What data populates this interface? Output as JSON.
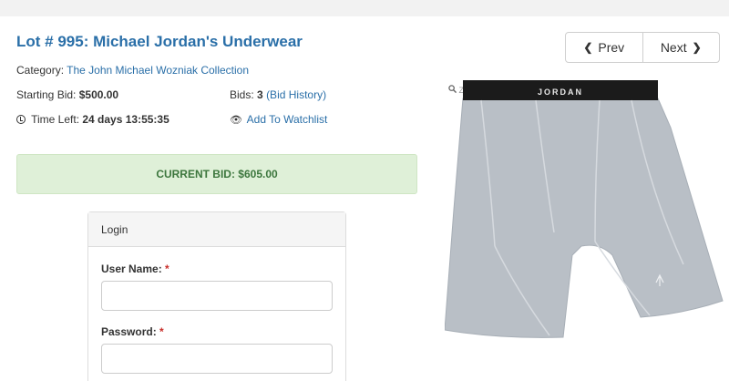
{
  "lot": {
    "title": "Lot # 995: Michael Jordan's Underwear",
    "category_label": "Category:",
    "category_value": "The John Michael Wozniak Collection",
    "starting_bid_label": "Starting Bid:",
    "starting_bid_value": "$500.00",
    "bids_label": "Bids:",
    "bids_count": "3",
    "bid_history_link": "(Bid History)",
    "time_left_label": "Time Left:",
    "time_left_value": "24 days 13:55:35",
    "watchlist_link": "Add To Watchlist",
    "current_bid": "CURRENT BID: $605.00"
  },
  "pager": {
    "prev_label": "Prev",
    "next_label": "Next"
  },
  "login": {
    "header": "Login",
    "username_label": "User Name:",
    "password_label": "Password:",
    "required_mark": "*"
  },
  "product": {
    "zoom_label": "Zoom",
    "waistband_text": "JORDAN"
  },
  "icons": {
    "clock": "clock-icon",
    "eye": "eye-icon",
    "zoom": "magnifier-icon",
    "prev": "chevron-left-icon",
    "next": "chevron-right-icon"
  },
  "colors": {
    "link": "#2a6fa8",
    "bid_bg": "#dff0d8",
    "bid_text": "#3c763d",
    "required": "#c9302c"
  }
}
